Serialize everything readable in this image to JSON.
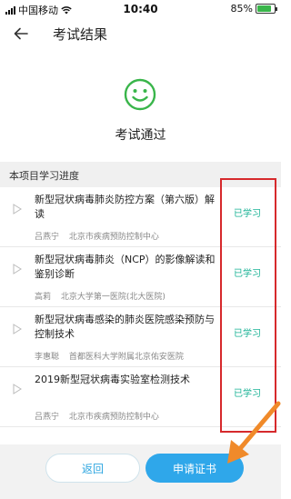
{
  "status_bar": {
    "carrier": "中国移动",
    "time": "10:40",
    "battery": "85%",
    "battery_level": 0.85,
    "battery_color": "#39b54a"
  },
  "header": {
    "title": "考试结果",
    "back_icon": "arrow-left-icon"
  },
  "result": {
    "icon": "smiley-icon",
    "text": "考试通过",
    "color": "#39b54a"
  },
  "progress": {
    "section_title": "本项目学习进度",
    "courses": [
      {
        "title": "新型冠状病毒肺炎防控方案（第六版）解读",
        "author": "吕燕宁",
        "org": "北京市疾病预防控制中心",
        "status": "已学习"
      },
      {
        "title": "新型冠状病毒肺炎（NCP）的影像解读和鉴别诊断",
        "author": "高莉",
        "org": "北京大学第一医院(北大医院)",
        "status": "已学习"
      },
      {
        "title": "新型冠状病毒感染的肺炎医院感染预防与控制技术",
        "author": "李惠聪",
        "org": "首都医科大学附属北京佑安医院",
        "status": "已学习"
      },
      {
        "title": "2019新型冠状病毒实验室检测技术",
        "author": "吕燕宁",
        "org": "北京市疾病预防控制中心",
        "status": "已学习"
      }
    ]
  },
  "footer": {
    "back_label": "返回",
    "apply_label": "申请证书"
  },
  "colors": {
    "accent": "#2fa7ea",
    "status": "#1bb396",
    "annotation": "#d6292c",
    "arrow": "#f08a2a"
  }
}
